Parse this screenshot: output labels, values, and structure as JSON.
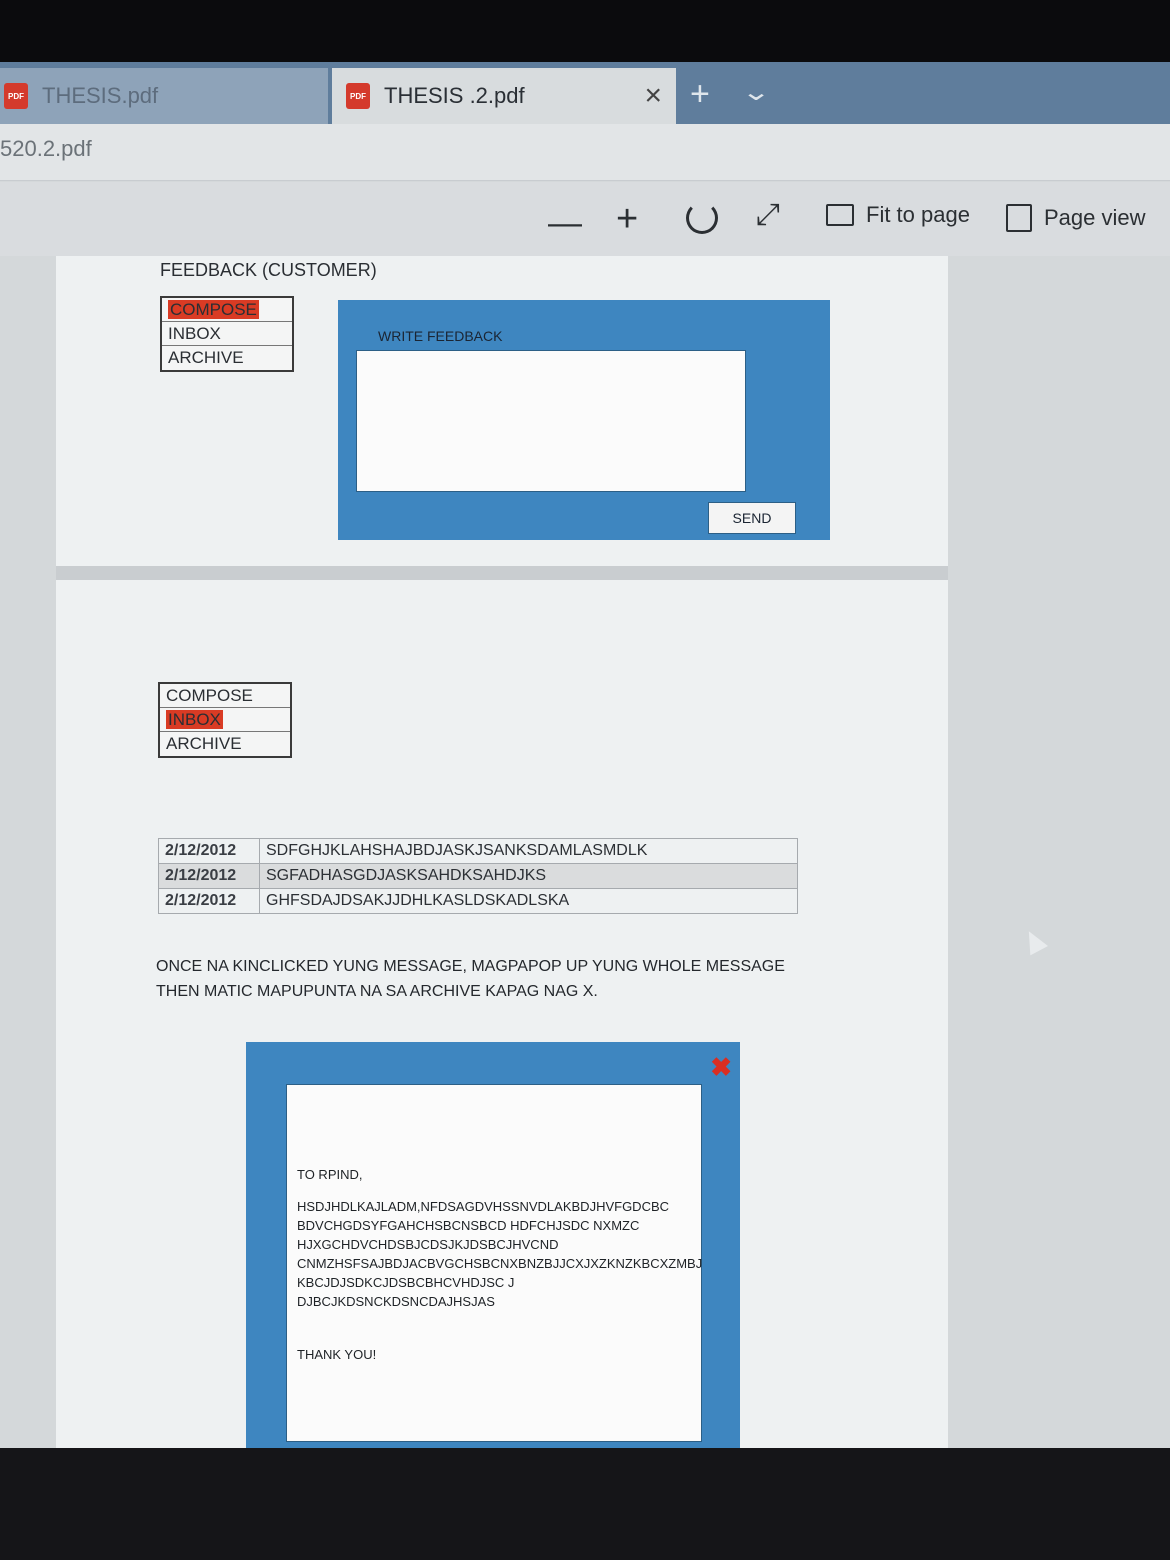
{
  "tabs": [
    {
      "label": "THESIS.pdf",
      "icon": "pdf-icon",
      "active": false
    },
    {
      "label": "THESIS .2.pdf",
      "icon": "pdf-icon",
      "active": true
    }
  ],
  "tab_controls": {
    "close": "×",
    "new_tab": "+",
    "tab_list": "⌄"
  },
  "address": "520.2.pdf",
  "toolbar": {
    "zoom_out": "—",
    "zoom_in": "+",
    "expand": "⤢",
    "fit_label": "Fit to page",
    "page_view_label": "Page view"
  },
  "page1": {
    "title": "FEEDBACK (CUSTOMER)",
    "menu": [
      "COMPOSE",
      "INBOX",
      "ARCHIVE"
    ],
    "menu_selected": "COMPOSE",
    "write_label": "WRITE FEEDBACK",
    "send_label": "SEND"
  },
  "page2": {
    "menu": [
      "COMPOSE",
      "INBOX",
      "ARCHIVE"
    ],
    "menu_selected": "INBOX",
    "messages": [
      {
        "date": "2/12/2012",
        "text": "SDFGHJKLAHSHAJBDJASKJSANKSDAMLASMDLK"
      },
      {
        "date": "2/12/2012",
        "text": "SGFADHASGDJASKSAHDKSAHDJKS"
      },
      {
        "date": "2/12/2012",
        "text": "GHFSDAJDSAKJJDHLKASLDSKADLSKA"
      }
    ],
    "note_line1": "ONCE NA KINCLICKED YUNG MESSAGE, MAGPAPOP UP YUNG WHOLE MESSAGE",
    "note_line2": "THEN MATIC MAPUPUNTA NA SA ARCHIVE KAPAG NAG X.",
    "popup": {
      "close": "✖",
      "greeting": "TO RPIND,",
      "body_lines": [
        "HSDJHDLKAJLADM,NFDSAGDVHSSNVDLAKBDJHVFGDCBC",
        "BDVCHGDSYFGAHCHSBCNSBCD HDFCHJSDC NXMZC",
        "HJXGCHDVCHDSBJCDSJKJDSBCJHVCND",
        "CNMZHSFSAJBDJACBVGCHSBCNXBNZBJJCXJXZKNZKBCXZMBJ",
        "KBCJDJSDKCJDSBCBHCVHDJSC J DJBCJKDSNCKDSNCDAJHSJAS"
      ],
      "closing": "THANK YOU!"
    }
  },
  "colors": {
    "accent_blue": "#3e86c0",
    "highlight_red": "#d93b24",
    "close_red": "#d92e22"
  }
}
